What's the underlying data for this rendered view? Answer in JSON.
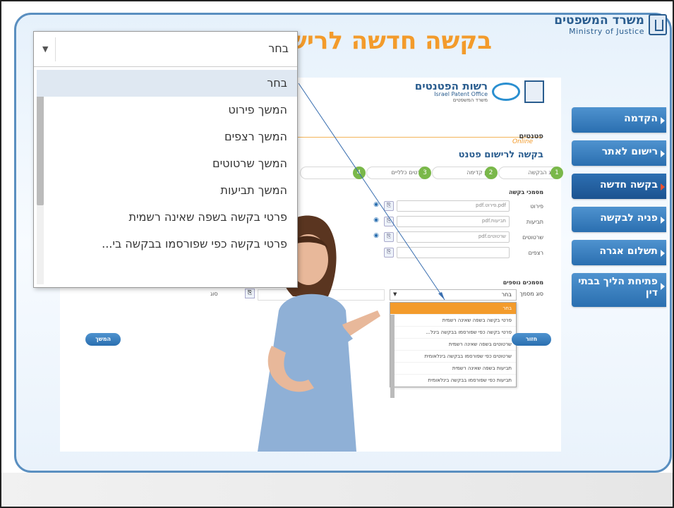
{
  "ministry": {
    "name_he": "משרד המשפטים",
    "name_en": "Ministry of Justice"
  },
  "page_title": "בקשה חדשה לרישום פטנט",
  "nav": [
    {
      "label": "הקדמה",
      "active": false
    },
    {
      "label": "רישום לאתר",
      "active": false
    },
    {
      "label": "בקשה חדשה",
      "active": true
    },
    {
      "label": "פניה לבקשה",
      "active": false
    },
    {
      "label": "תשלום אגרה",
      "active": false
    },
    {
      "label": "פתיחת הליך בבתי דין",
      "active": false
    }
  ],
  "form": {
    "office_he": "רשות הפטנטים",
    "office_en": "Israel Patent Office",
    "office_sub": "משרד המשפטים",
    "patents": "פטנטים",
    "online": "Online",
    "title": "בקשה לרישום פטנט",
    "steps": [
      {
        "num": "1",
        "label": "סוג הבקשה"
      },
      {
        "num": "2",
        "label": "דין קדימה"
      },
      {
        "num": "3",
        "label": "פרטים כלליים"
      },
      {
        "num": "4",
        "label": "מ"
      }
    ],
    "docs_section": "מסמכי בקשה",
    "docs": [
      {
        "label": "פירוט",
        "value": "pdf.פירוט.pdf"
      },
      {
        "label": "תביעות",
        "value": "pdf.תביעות"
      },
      {
        "label": "שרטוטים",
        "value": "pdf.שרטוטים"
      },
      {
        "label": "רצפים",
        "value": ""
      }
    ],
    "extra_section": "מסמכים נוספים",
    "doc_type_label": "סוג מסמך",
    "other_label": "סוג",
    "small_select_value": "בחר",
    "small_options": [
      "בחר",
      "פרטי בקשה בשפה שאינה רשמית",
      "פרטי בקשה כפי שפורסמו בבקשה בינל...",
      "שרטוטים בשפה שאינה רשמית",
      "שרטוטים כפי שפורסמו בבקשה בינלאומית",
      "תביעות בשפה שאינה רשמית",
      "תביעות כפי שפורסמו בבקשה בינלאומית"
    ],
    "back_button": "חזור",
    "next_button": "המשך"
  },
  "big_dropdown": {
    "value": "בחר",
    "options": [
      "בחר",
      "המשך פירוט",
      "המשך רצפים",
      "המשך שרטוטים",
      "המשך תביעות",
      "פרטי בקשה בשפה שאינה רשמית",
      "פרטי בקשה כפי שפורסמו בבקשה בי..."
    ]
  },
  "colors": {
    "accent_orange": "#f39b2b",
    "nav_blue": "#2a6fb0",
    "title_blue": "#2a5d8f"
  }
}
